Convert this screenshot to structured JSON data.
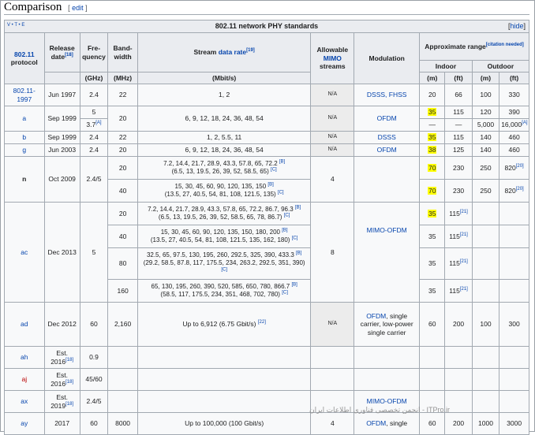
{
  "heading": {
    "title": "Comparison",
    "edit_open": "[ ",
    "edit": "edit",
    "edit_close": " ]"
  },
  "navbox": {
    "vte": "V • T • E",
    "title": "802.11 network PHY standards",
    "hide_open": "[",
    "hide": "hide",
    "hide_close": "]"
  },
  "headers": {
    "protocol_link": "802.11",
    "protocol": "protocol",
    "release": "Release date",
    "release_ref": "[18]",
    "freq": "Fre-quency",
    "freq_unit": "(GHz)",
    "bw": "Band-width",
    "bw_unit": "(MHz)",
    "rate_pre": "Stream ",
    "rate_link": "data rate",
    "rate_ref": "[19]",
    "rate_unit": "(Mbit/s)",
    "mimo_pre": "Allowable",
    "mimo_link": "MIMO",
    "mimo_post": "streams",
    "modulation": "Modulation",
    "range": "Approximate range",
    "range_cite": "[citation needed]",
    "indoor": "Indoor",
    "outdoor": "Outdoor",
    "m": "(m)",
    "ft": "(ft)"
  },
  "rows": {
    "r1997": {
      "proto": "802.11-1997",
      "date": "Jun 1997",
      "freq": "2.4",
      "bw": "22",
      "rate": "1, 2",
      "mimo": "N/A",
      "mod": "DSSS, FHSS",
      "im": "20",
      "ift": "66",
      "om": "100",
      "oft": "330"
    },
    "a": {
      "proto": "a",
      "date": "Sep 1999",
      "freq1": "5",
      "freq2": "3.7",
      "freq2_ref": "[A]",
      "bw": "20",
      "rate": "6, 9, 12, 18, 24, 36, 48, 54",
      "mimo": "N/A",
      "mod": "OFDM",
      "im": "35",
      "ift": "115",
      "om": "120",
      "oft": "390",
      "im2": "—",
      "ift2": "—",
      "om2": "5,000",
      "oft2": "16,000",
      "oft2_ref": "[A]"
    },
    "b": {
      "proto": "b",
      "date": "Sep 1999",
      "freq": "2.4",
      "bw": "22",
      "rate": "1, 2, 5.5, 11",
      "mimo": "N/A",
      "mod": "DSSS",
      "im": "35",
      "ift": "115",
      "om": "140",
      "oft": "460"
    },
    "g": {
      "proto": "g",
      "date": "Jun 2003",
      "freq": "2.4",
      "bw": "20",
      "rate": "6, 9, 12, 18, 24, 36, 48, 54",
      "mimo": "N/A",
      "mod": "OFDM",
      "im": "38",
      "ift": "125",
      "om": "140",
      "oft": "460"
    },
    "n": {
      "proto": "n",
      "date": "Oct 2009",
      "freq": "2.4/5",
      "mimo": "4",
      "bw1": "20",
      "rate1a": "7.2, 14.4, 21.7, 28.9, 43.3, 57.8, 65, 72.2",
      "ref1a": "[B]",
      "rate1b": "(6.5, 13, 19.5, 26, 39, 52, 58.5, 65)",
      "ref1b": "[C]",
      "im1": "70",
      "ift1": "230",
      "om1": "250",
      "oft1": "820",
      "oft1_ref": "[20]",
      "bw2": "40",
      "rate2a": "15, 30, 45, 60, 90, 120, 135, 150",
      "ref2a": "[B]",
      "rate2b": "(13.5, 27, 40.5, 54, 81, 108, 121.5, 135)",
      "ref2b": "[C]",
      "im2": "70",
      "ift2": "230",
      "om2": "250",
      "oft2": "820",
      "oft2_ref": "[20]"
    },
    "ac": {
      "proto": "ac",
      "date": "Dec 2013",
      "freq": "5",
      "mimo": "8",
      "mod": "MIMO-OFDM",
      "bw1": "20",
      "rate1a": "7.2, 14.4, 21.7, 28.9, 43.3, 57.8, 65, 72.2, 86.7, 96.3",
      "ref1a": "[B]",
      "rate1b": "(6.5, 13, 19.5, 26, 39, 52, 58.5, 65, 78, 86.7)",
      "ref1b": "[C]",
      "im1": "35",
      "ift1": "115",
      "ift1_ref": "[21]",
      "bw2": "40",
      "rate2a": "15, 30, 45, 60, 90, 120, 135, 150, 180, 200",
      "ref2a": "[B]",
      "rate2b": "(13.5, 27, 40.5, 54, 81, 108, 121.5, 135, 162, 180)",
      "ref2b": "[C]",
      "im2": "35",
      "ift2": "115",
      "ift2_ref": "[21]",
      "bw3": "80",
      "rate3a": "32.5, 65, 97.5, 130, 195, 260, 292.5, 325, 390, 433.3",
      "ref3a": "[B]",
      "rate3b": "(29.2, 58.5, 87.8, 117, 175.5, 234, 263.2, 292.5, 351, 390)",
      "ref3b": "[C]",
      "im3": "35",
      "ift3": "115",
      "ift3_ref": "[21]",
      "bw4": "160",
      "rate4a": "65, 130, 195, 260, 390, 520, 585, 650, 780, 866.7",
      "ref4a": "[B]",
      "rate4b": "(58.5, 117, 175.5, 234, 351, 468, 702, 780)",
      "ref4b": "[C]",
      "im4": "35",
      "ift4": "115",
      "ift4_ref": "[21]"
    },
    "ad": {
      "proto": "ad",
      "date": "Dec 2012",
      "freq": "60",
      "bw": "2,160",
      "rate": "Up to 6,912 (6.75 Gbit/s)",
      "rate_ref": "[22]",
      "mimo": "N/A",
      "mod": "OFDM, single carrier, low-power single carrier",
      "mod_link": "OFDM",
      "mod_rest": ", single carrier, low-power single carrier",
      "im": "60",
      "ift": "200",
      "om": "100",
      "oft": "300"
    },
    "ah": {
      "proto": "ah",
      "date1": "Est.",
      "date2": "2016",
      "date_ref": "[18]",
      "freq": "0.9"
    },
    "aj": {
      "proto": "aj",
      "date1": "Est.",
      "date2": "2016",
      "date_ref": "[18]",
      "freq": "45/60"
    },
    "ax": {
      "proto": "ax",
      "date1": "Est.",
      "date2": "2019",
      "date_ref": "[18]",
      "freq": "2.4/5",
      "mod": "MIMO-OFDM"
    },
    "ay": {
      "proto": "ay",
      "date": "2017",
      "freq": "60",
      "bw": "8000",
      "rate": "Up to 100,000 (100 Gbit/s)",
      "mimo": "4",
      "mod_link": "OFDM",
      "mod_rest": ", single",
      "im": "60",
      "ift": "200",
      "om": "1000",
      "oft": "3000"
    }
  },
  "watermark": "انجمن تخصصی فناوری اطلاعات ایران - ITPro.ir"
}
